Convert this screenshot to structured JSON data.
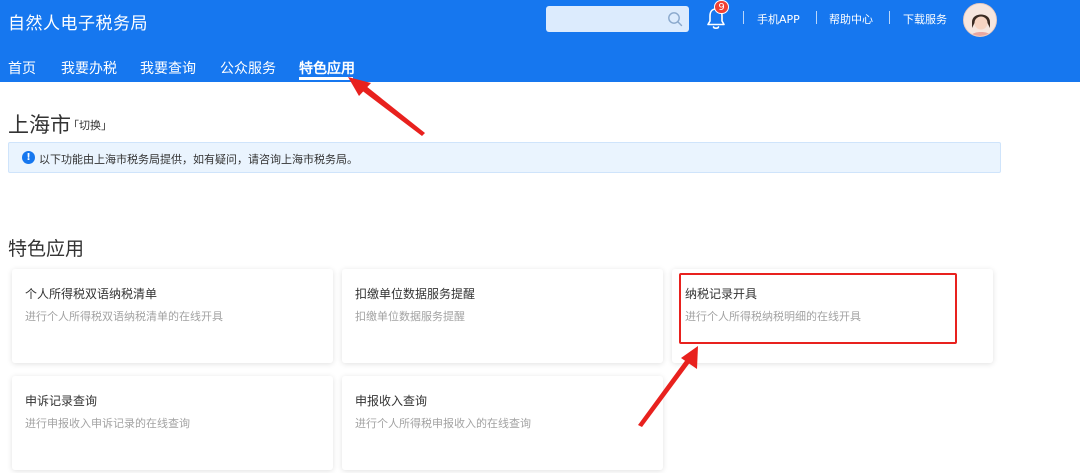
{
  "header": {
    "app_title": "自然人电子税务局",
    "search_placeholder": "",
    "notification_count": "9",
    "links": [
      "手机APP",
      "帮助中心",
      "下载服务"
    ]
  },
  "nav": {
    "items": [
      "首页",
      "我要办税",
      "我要查询",
      "公众服务",
      "特色应用"
    ],
    "active_index": 4
  },
  "region": {
    "city": "上海市",
    "switch_label": "「切换」"
  },
  "notice": {
    "text": "以下功能由上海市税务局提供，如有疑问，请咨询上海市税务局。"
  },
  "section": {
    "title": "特色应用"
  },
  "cards": [
    {
      "title": "个人所得税双语纳税清单",
      "desc": "进行个人所得税双语纳税清单的在线开具"
    },
    {
      "title": "扣缴单位数据服务提醒",
      "desc": "扣缴单位数据服务提醒"
    },
    {
      "title": "纳税记录开具",
      "desc": "进行个人所得税纳税明细的在线开具"
    },
    {
      "title": "申诉记录查询",
      "desc": "进行申报收入申诉记录的在线查询"
    },
    {
      "title": "申报收入查询",
      "desc": "进行个人所得税申报收入的在线查询"
    }
  ],
  "colors": {
    "brand": "#1677ef",
    "annotation": "#e8211e",
    "badge": "#f04134"
  }
}
